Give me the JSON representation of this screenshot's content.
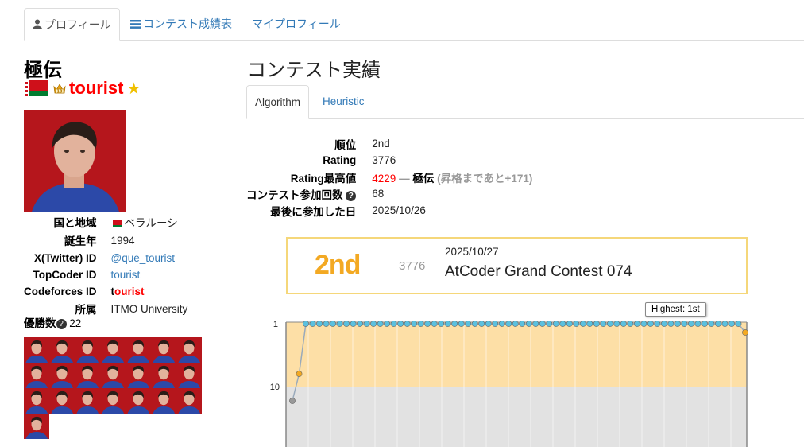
{
  "top_tabs": [
    {
      "label": "プロフィール",
      "active": true
    },
    {
      "label": "コンテスト成績表",
      "active": false
    },
    {
      "label": "マイプロフィール",
      "active": false
    }
  ],
  "profile": {
    "rank_title": "極伝",
    "username": "tourist",
    "username_first": "t",
    "username_rest": "ourist",
    "star": "★",
    "colors": {
      "user": "#ff0000",
      "link": "#337ab7",
      "accent": "#f3a923"
    },
    "info": [
      {
        "label": "国と地域",
        "value": "ベラルーシ"
      },
      {
        "label": "誕生年",
        "value": "1994"
      },
      {
        "label": "X(Twitter) ID",
        "value": "@que_tourist"
      },
      {
        "label": "TopCoder ID",
        "value": "tourist"
      },
      {
        "label": "Codeforces ID",
        "value": "tourist"
      },
      {
        "label": "所属",
        "value": "ITMO University"
      }
    ],
    "wins_label": "優勝数",
    "wins_value": "22"
  },
  "contest": {
    "title": "コンテスト実績",
    "tabs": [
      {
        "label": "Algorithm",
        "active": true
      },
      {
        "label": "Heuristic",
        "active": false
      }
    ],
    "stats": {
      "rank_label": "順位",
      "rank_value": "2nd",
      "rating_label": "Rating",
      "rating_value": "3776",
      "max_label": "Rating最高値",
      "max_value": "4229",
      "max_sep": " — ",
      "max_title": "極伝",
      "max_note": "(昇格まであと+171)",
      "count_label": "コンテスト参加回数",
      "count_value": "68",
      "last_label": "最後に参加した日",
      "last_value": "2025/10/26"
    },
    "latest": {
      "place": "2nd",
      "performance": "3776",
      "date": "2025/10/27",
      "name": "AtCoder Grand Contest 074"
    }
  },
  "chart_data": {
    "type": "line",
    "y_tick_labels": [
      "1",
      "10"
    ],
    "tooltip": "Highest: 1st",
    "series": [
      {
        "color": "#5bc0de"
      }
    ],
    "ranks_mostly": 1,
    "point_count": 68
  }
}
